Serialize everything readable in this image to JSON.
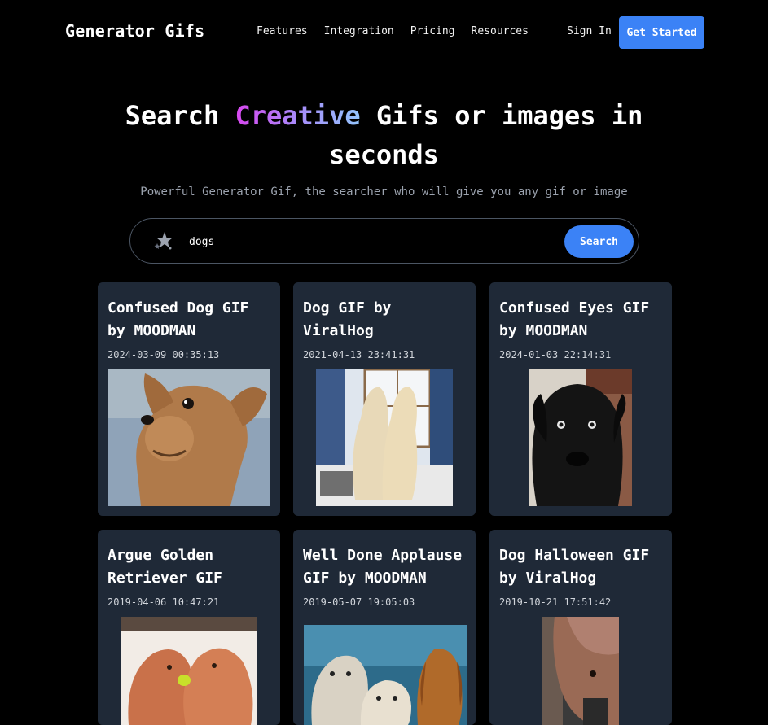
{
  "nav": {
    "brand": "Generator Gifs",
    "links": [
      "Features",
      "Integration",
      "Pricing",
      "Resources"
    ],
    "sign_in": "Sign In",
    "get_started": "Get Started"
  },
  "hero": {
    "title_part1": "Search ",
    "title_accent": "Creative",
    "title_part2": " Gifs or images in",
    "title_line2": "seconds",
    "subtitle": "Powerful Generator Gif, the searcher who will give you any gif or image"
  },
  "search": {
    "value": "dogs",
    "placeholder": "",
    "button": "Search",
    "icon": "sparkle-star-icon"
  },
  "results": [
    {
      "title_line1": "Confused Dog GIF",
      "title_line2": "by MOODMAN",
      "date": "2024-03-09 00:35:13"
    },
    {
      "title_line1": "Dog GIF by",
      "title_line2": "ViralHog",
      "date": "2021-04-13 23:41:31"
    },
    {
      "title_line1": "Confused Eyes GIF",
      "title_line2": "by MOODMAN",
      "date": "2024-01-03 22:14:31"
    },
    {
      "title_line1": "Argue Golden",
      "title_line2": "Retriever GIF",
      "date": "2019-04-06 10:47:21"
    },
    {
      "title_line1": "Well Done Applause",
      "title_line2": "GIF by MOODMAN",
      "date": "2019-05-07 19:05:03"
    },
    {
      "title_line1": "Dog Halloween GIF",
      "title_line2": "by ViralHog",
      "date": "2019-10-21 17:51:42"
    }
  ],
  "colors": {
    "background": "#000000",
    "card": "#1f2937",
    "accent": "#3b82f6"
  }
}
